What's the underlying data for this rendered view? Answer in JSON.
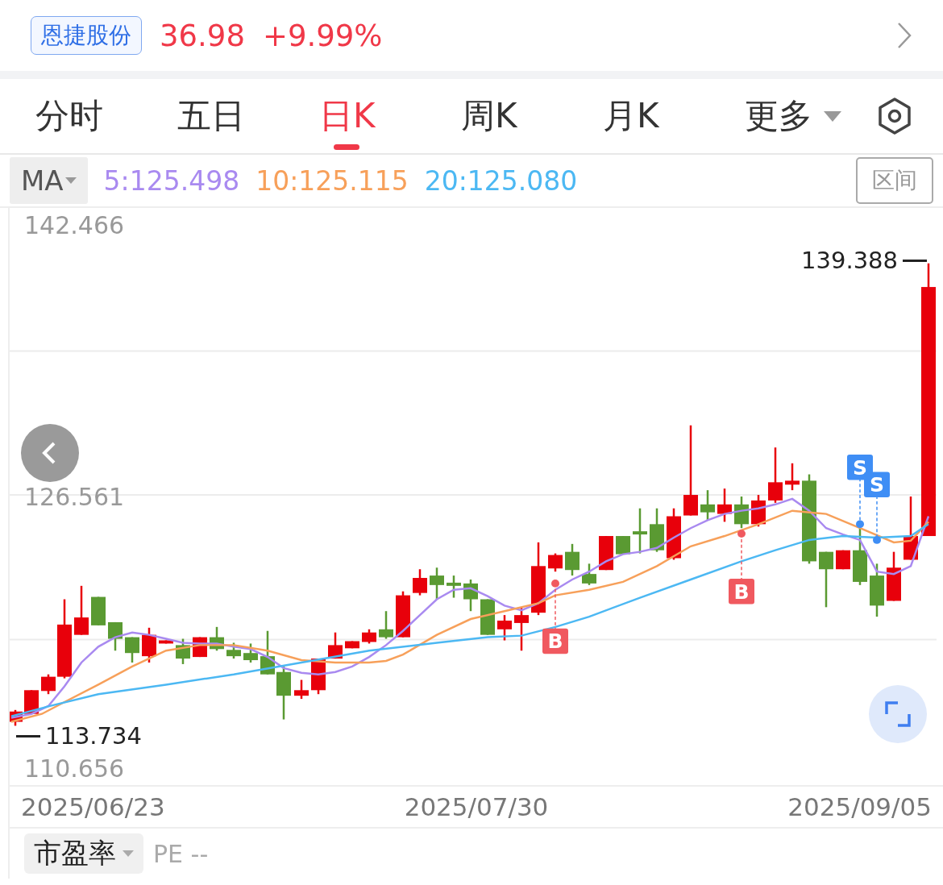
{
  "header": {
    "stock_name": "恩捷股份",
    "price": "36.98",
    "change": "+9.99%"
  },
  "tabs": [
    {
      "label": "分时",
      "selected": false
    },
    {
      "label": "五日",
      "selected": false
    },
    {
      "label": "日K",
      "selected": true
    },
    {
      "label": "周K",
      "selected": false
    },
    {
      "label": "月K",
      "selected": false
    }
  ],
  "more_menu": {
    "label": "更多"
  },
  "indicator": {
    "label": "MA"
  },
  "moving_averages": [
    {
      "label": "5:125.498",
      "color": "#a98af0"
    },
    {
      "label": "10:125.115",
      "color": "#f7a05a"
    },
    {
      "label": "20:125.080",
      "color": "#4cb8f3"
    }
  ],
  "range_button": {
    "label": "区间"
  },
  "chart": {
    "y_labels": [
      "142.466",
      "126.561",
      "110.656"
    ],
    "high_label": "139.388",
    "low_label": "113.734",
    "markers": [
      {
        "kind": "buy",
        "label": "B"
      },
      {
        "kind": "buy",
        "label": "B"
      },
      {
        "kind": "sell",
        "label": "S"
      },
      {
        "kind": "sell",
        "label": "S"
      }
    ],
    "x_labels": [
      "2025/06/23",
      "2025/07/30",
      "2025/09/05"
    ]
  },
  "bottom": {
    "metric": "市盈率",
    "value": "PE --"
  }
}
